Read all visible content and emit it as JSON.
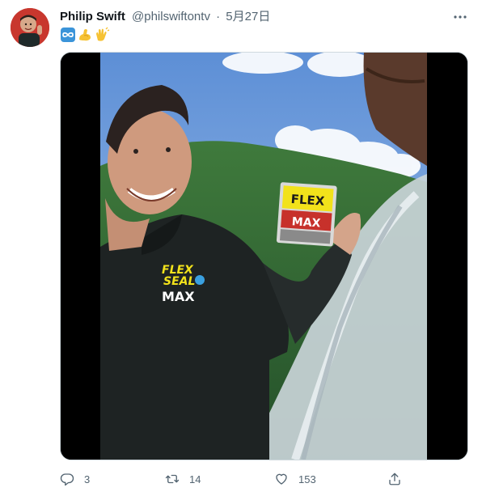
{
  "tweet": {
    "author_name": "Philip Swift",
    "handle": "@philswiftontv",
    "separator": "·",
    "date": "5月27日",
    "emojis": [
      "infinity-emoji",
      "flexed-biceps-emoji",
      "clapping-hands-emoji"
    ],
    "media": {
      "shirt_logo_line1": "FLEX",
      "shirt_logo_line2": "SEAL",
      "shirt_logo_line3": "MAX",
      "package_label_top": "FLEX",
      "package_label_bottom": "MAX"
    },
    "actions": {
      "reply_count": "3",
      "retweet_count": "14",
      "like_count": "153"
    }
  },
  "colors": {
    "text_primary": "#0f1419",
    "text_secondary": "#536471",
    "media_background": "#000000",
    "logo_yellow": "#f2e21b"
  },
  "icons": {
    "more": "more-icon",
    "reply": "reply-icon",
    "retweet": "retweet-icon",
    "like": "heart-icon",
    "share": "share-icon"
  }
}
